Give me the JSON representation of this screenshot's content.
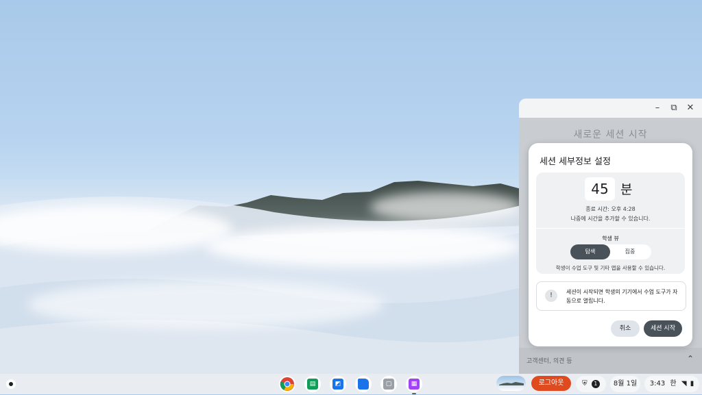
{
  "window": {
    "heading": "새로운 세션 시작",
    "footer_text": "고객센터, 의견 등"
  },
  "dialog": {
    "title": "세션 세부정보 설정",
    "duration_value": "45",
    "duration_unit": "분",
    "end_time": "종료 시간: 오후 4:28",
    "add_later": "나중에 시간을 추가할 수 있습니다.",
    "student_view_label": "학생 뷰",
    "view_options": [
      "탐색",
      "집중"
    ],
    "selected_view": "탐색",
    "view_description": "학생이 수업 도구 및 기타 앱을 사용할 수 있습니다.",
    "info_text": "세션이 시작되면 학생의 기기에서 수업 도구가 자동으로 열립니다.",
    "cancel_label": "취소",
    "start_label": "세션 시작"
  },
  "shelf": {
    "logout_label": "로그아웃",
    "notification_count": "1",
    "date": "8월 1일",
    "time": "3:43",
    "ime": "한",
    "apps": [
      "chrome-icon",
      "classroom-app-icon",
      "docs-app-icon",
      "files-icon",
      "screen-capture-icon",
      "class-tools-icon"
    ]
  },
  "colors": {
    "accent_dark": "#4a5259",
    "logout_red": "#e04a1f"
  }
}
